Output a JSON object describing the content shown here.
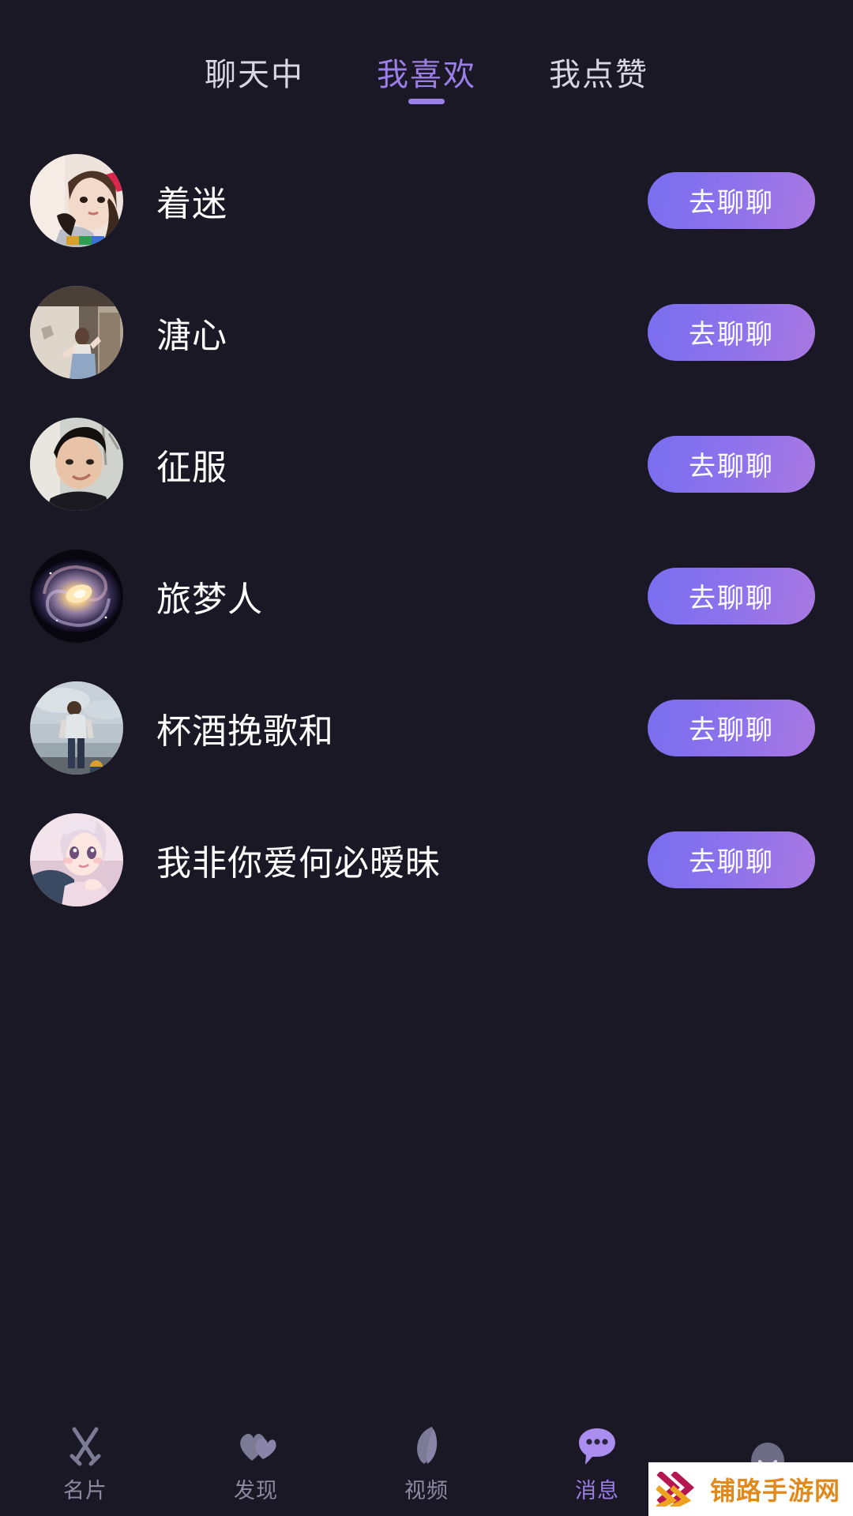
{
  "theme": {
    "background": "#1b1825",
    "accent": "#9b7ee8",
    "button_gradient_start": "#7b6ef0",
    "button_gradient_end": "#a978e2",
    "text_primary": "#ffffff",
    "text_muted": "#8c89a0"
  },
  "tabs": [
    {
      "label": "聊天中",
      "active": false
    },
    {
      "label": "我喜欢",
      "active": true
    },
    {
      "label": "我点赞",
      "active": false
    }
  ],
  "list": [
    {
      "name": "着迷",
      "action_label": "去聊聊",
      "avatar": "girl-headband"
    },
    {
      "name": "溏心",
      "action_label": "去聊聊",
      "avatar": "room-girl"
    },
    {
      "name": "征服",
      "action_label": "去聊聊",
      "avatar": "man-portrait"
    },
    {
      "name": "旅梦人",
      "action_label": "去聊聊",
      "avatar": "galaxy"
    },
    {
      "name": "杯酒挽歌和",
      "action_label": "去聊聊",
      "avatar": "man-standing"
    },
    {
      "name": "我非你爱何必暧昧",
      "action_label": "去聊聊",
      "avatar": "anime-girl"
    }
  ],
  "bottom_nav": [
    {
      "label": "名片",
      "icon": "crossed-swords-icon",
      "active": false
    },
    {
      "label": "发现",
      "icon": "hearts-icon",
      "active": false
    },
    {
      "label": "视频",
      "icon": "leaf-icon",
      "active": false
    },
    {
      "label": "消息",
      "icon": "chat-bubble-icon",
      "active": true
    },
    {
      "label": "",
      "icon": "smiley-face-icon",
      "active": false
    }
  ],
  "watermark": {
    "text": "铺路手游网"
  }
}
